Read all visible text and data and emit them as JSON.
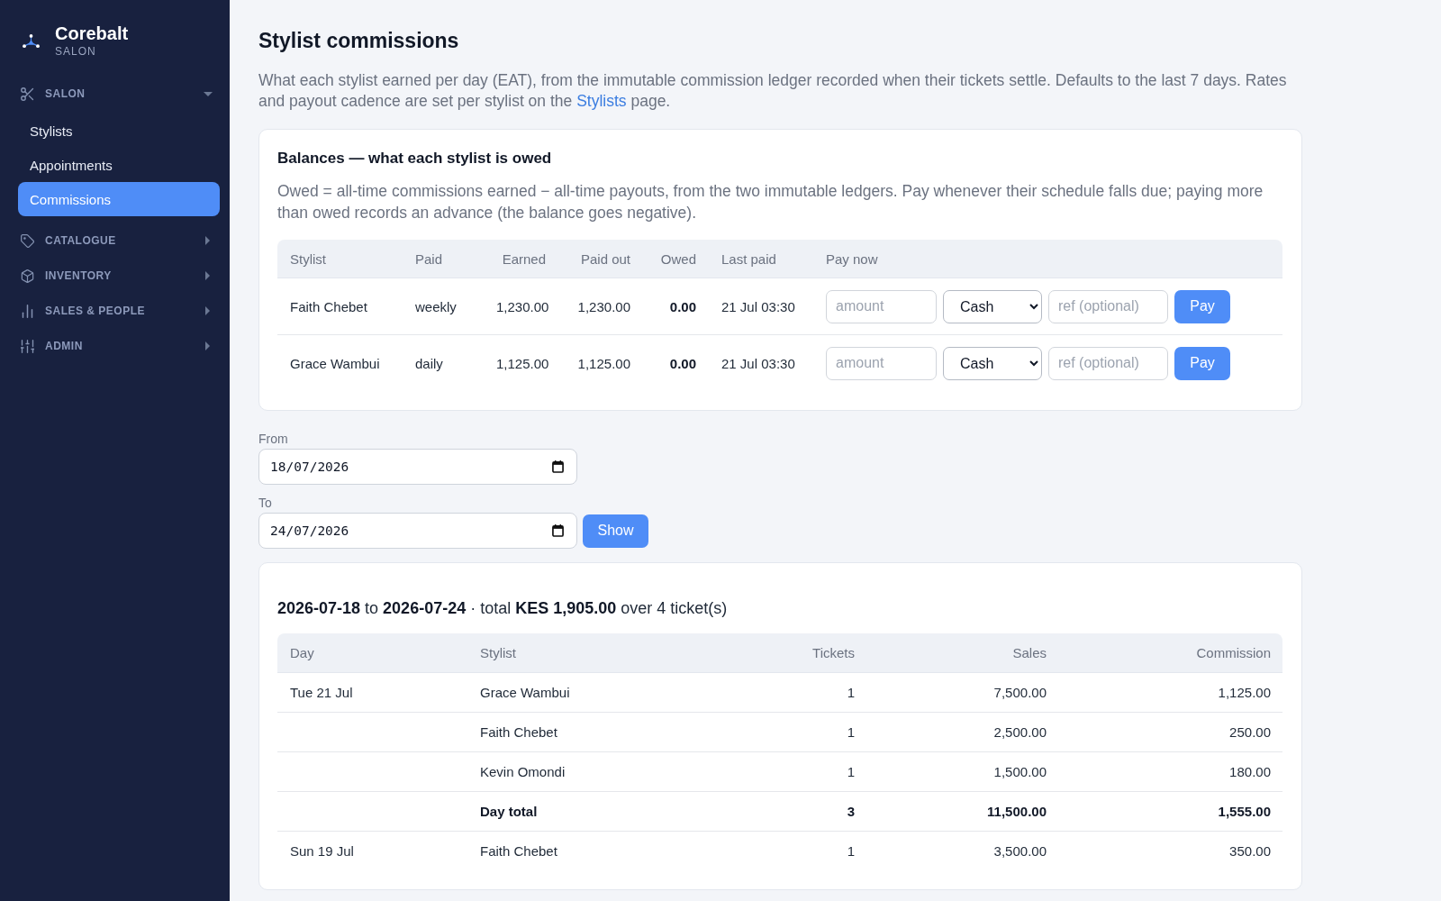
{
  "sidebar": {
    "brand": {
      "name": "Corebalt",
      "subtitle": "SALON"
    },
    "sections": [
      {
        "label": "SALON",
        "expanded": true,
        "items": [
          {
            "label": "Stylists",
            "selected": false
          },
          {
            "label": "Appointments",
            "selected": false
          },
          {
            "label": "Commissions",
            "selected": true
          }
        ]
      },
      {
        "label": "CATALOGUE",
        "expanded": false
      },
      {
        "label": "INVENTORY",
        "expanded": false
      },
      {
        "label": "SALES & PEOPLE",
        "expanded": false
      },
      {
        "label": "ADMIN",
        "expanded": false
      }
    ]
  },
  "page": {
    "title": "Stylist commissions",
    "description": {
      "text": "What each stylist earned per day (EAT), from the immutable commission ledger recorded when their tickets settle. Defaults to the last 7 days. Rates and payout cadence are set per stylist on the ",
      "link": "Stylists",
      "text_after": " page."
    }
  },
  "balances": {
    "title": "Balances — what each stylist is owed",
    "description": "Owed = all-time commissions earned − all-time payouts, from the two immutable ledgers. Pay whenever their schedule falls due; paying more than owed records an advance (the balance goes negative).",
    "table": {
      "columns": [
        "Stylist",
        "Paid",
        "Earned",
        "Paid out",
        "Owed",
        "Last paid",
        "Pay now"
      ],
      "rows": [
        {
          "stylist": "Faith Chebet",
          "paid": "weekly",
          "earned": "1,230.00",
          "paid_out": "1,230.00",
          "owed": "0.00",
          "last_paid": "21 Jul 03:30",
          "pay_now": {
            "amount": {
              "placeholder": "amount"
            },
            "method": {
              "value": "Cash"
            },
            "reference": {
              "placeholder": "ref (optional)"
            },
            "button": "Pay"
          }
        },
        {
          "stylist": "Grace Wambui",
          "paid": "daily",
          "earned": "1,125.00",
          "paid_out": "1,125.00",
          "owed": "0.00",
          "last_paid": "21 Jul 03:30",
          "pay_now": {
            "amount": {
              "placeholder": "amount"
            },
            "method": {
              "value": "Cash"
            },
            "reference": {
              "placeholder": "ref (optional)"
            },
            "button": "Pay"
          }
        }
      ]
    }
  },
  "filters": {
    "from": {
      "label": "From",
      "value": "18/07/2026"
    },
    "to": {
      "label": "To",
      "value": "24/07/2026"
    },
    "button": "Show"
  },
  "results": {
    "summary": "**2026-07-18** to **2026-07-24** · total **KES 1,905.00** over 4 ticket(s)",
    "table": {
      "columns": [
        "Day",
        "Stylist",
        "Tickets",
        "Sales",
        "Commission"
      ],
      "rows": [
        {
          "kind": "entry",
          "day": "Tue 21 Jul",
          "stylist": "Grace Wambui",
          "tickets": "1",
          "sales": "7,500.00",
          "commission": "1,125.00"
        },
        {
          "kind": "entry",
          "stylist": "Faith Chebet",
          "tickets": "1",
          "sales": "2,500.00",
          "commission": "250.00"
        },
        {
          "kind": "entry",
          "stylist": "Kevin Omondi",
          "tickets": "1",
          "sales": "1,500.00",
          "commission": "180.00"
        },
        {
          "kind": "total",
          "stylist": "Day total",
          "tickets": "3",
          "sales": "11,500.00",
          "commission": "1,555.00"
        },
        {
          "kind": "entry",
          "day": "Sun 19 Jul",
          "stylist": "Faith Chebet",
          "tickets": "1",
          "sales": "3,500.00",
          "commission": "350.00"
        }
      ]
    }
  }
}
